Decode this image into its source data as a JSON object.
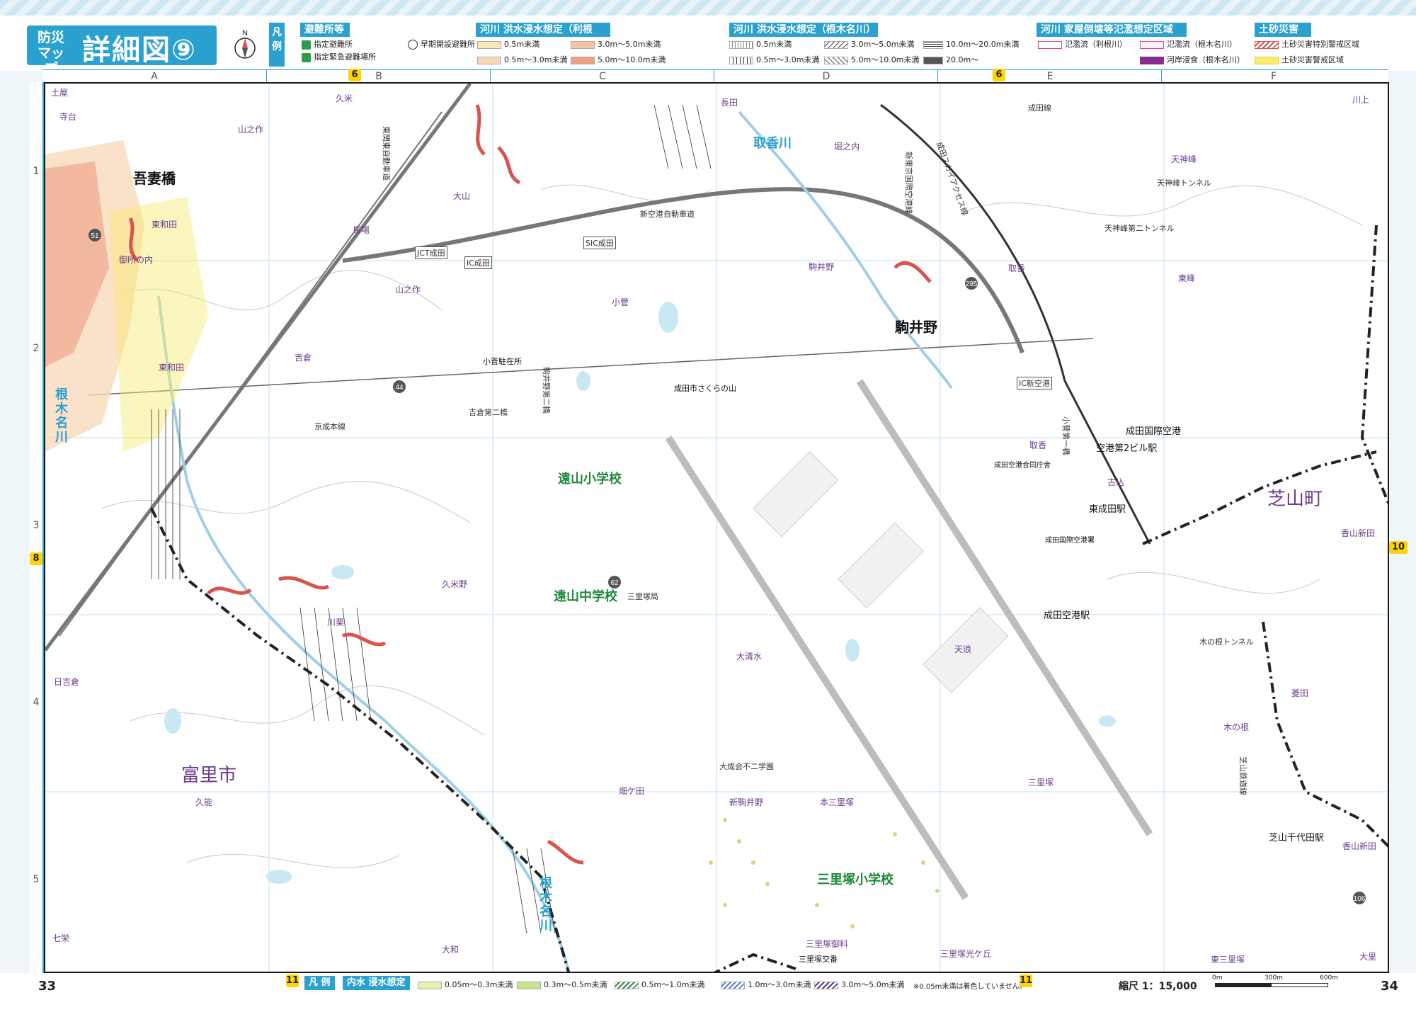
{
  "header": {
    "title_small": "防災\nマップ",
    "title_big": "詳細図⑨",
    "compass": "N",
    "legend_label": "凡例"
  },
  "legend": {
    "shelter": {
      "title": "避難所等",
      "items": [
        "指定避難所",
        "指定緊急避難場所",
        "早期開設避難所"
      ]
    },
    "tone_flood": {
      "title": "河川 洪水浸水想定（利根川）",
      "items": [
        "0.5m未満",
        "3.0m～5.0m未満",
        "0.5m～3.0m未満",
        "5.0m～10.0m未満"
      ]
    },
    "nekina_flood": {
      "title": "河川 洪水浸水想定（根木名川）",
      "items": [
        "0.5m未満",
        "3.0m～5.0m未満",
        "10.0m～20.0m未満",
        "0.5m～3.0m未満",
        "5.0m～10.0m未満",
        "20.0m～"
      ]
    },
    "house_collapse": {
      "title": "河川 家屋倒壊等氾濫想定区域",
      "items": [
        "氾濫流（利根川）",
        "氾濫流（根木名川）",
        "河岸浸食（根木名川）"
      ]
    },
    "sediment": {
      "title": "土砂災害",
      "items": [
        "土砂災害特別警戒区域",
        "土砂災害警戒区域"
      ]
    }
  },
  "grid": {
    "columns": [
      "A",
      "B",
      "C",
      "D",
      "E",
      "F"
    ],
    "rows": [
      "1",
      "2",
      "3",
      "4",
      "5"
    ],
    "edge_markers": {
      "top_left": "6",
      "top_right": "6",
      "left": "8",
      "right": "10",
      "bottom_left": "11",
      "bottom_right": "11"
    }
  },
  "places": [
    "土屋",
    "寺台",
    "久米",
    "山之作",
    "長田",
    "堀之内",
    "川上",
    "天神峰",
    "東和田",
    "馬場",
    "大山",
    "御所の内",
    "山之作",
    "小菅",
    "駒井野",
    "取香",
    "東峰",
    "東和田",
    "吉倉",
    "取香",
    "古込",
    "香山新田",
    "久米野",
    "川栗",
    "天浪",
    "大清水",
    "日吉倉",
    "菱田",
    "木の根",
    "畑ケ田",
    "新駒井野",
    "本三里塚",
    "三里塚",
    "久能",
    "香山新田",
    "七栄",
    "大和",
    "三里塚御料",
    "三里塚光ケ丘",
    "東三里塚",
    "大里"
  ],
  "big_places": [
    "富里市",
    "芝山町"
  ],
  "stations": {
    "big": [
      "吾妻橋",
      "駒井野"
    ],
    "small": [
      "成田国際空港",
      "空港第2ビル駅",
      "東成田駅",
      "成田空港駅",
      "芝山千代田駅",
      "成田空港合同庁舎",
      "成田国際空港署",
      "小菅駐在所",
      "成田市さくらの山",
      "三里塚交番"
    ]
  },
  "schools": [
    "遠山小学校",
    "遠山中学校",
    "三里塚小学校"
  ],
  "rivers": [
    "根木名川",
    "取香川",
    "根木名川"
  ],
  "roads": [
    "東関東自動車道",
    "新空港自動車道",
    "京成本線",
    "成田スカイアクセス線",
    "天神峰トンネル",
    "天神峰第二トンネル",
    "木の根トンネル",
    "吉倉第二橋",
    "芝山鉄道線",
    "成田線",
    "新東京国際空港線",
    "小菅第一橋",
    "駒井野第二橋",
    "三里塚局",
    "大成会不二学園"
  ],
  "route_numbers": [
    "51",
    "44",
    "62",
    "295",
    "106"
  ],
  "ic_labels": [
    "IC成田",
    "JCT成田",
    "SIC成田",
    "IC新空港"
  ],
  "footer": {
    "page_left": "33",
    "page_right": "34",
    "legend_label": "凡 例",
    "inland_title": "内水 浸水想定",
    "inland_items": [
      "0.05m～0.3m未満",
      "0.3m～0.5m未満",
      "0.5m～1.0m未満",
      "1.0m～3.0m未満",
      "3.0m～5.0m未満"
    ],
    "note": "※0.05m未満は着色していません。",
    "scale_label": "縮尺 1：15,000",
    "scale_ticks": [
      "0m",
      "300m",
      "600m"
    ]
  },
  "colors": {
    "accent": "#2aa1cf",
    "school": "#1e8a3a",
    "place": "#6a3b8e",
    "flood_low": "#fbe7b8",
    "flood_mid": "#f6bfa3",
    "flood_high": "#ef9f82",
    "sediment_red": "#d9534f",
    "sediment_yellow": "#f7ec6c"
  }
}
